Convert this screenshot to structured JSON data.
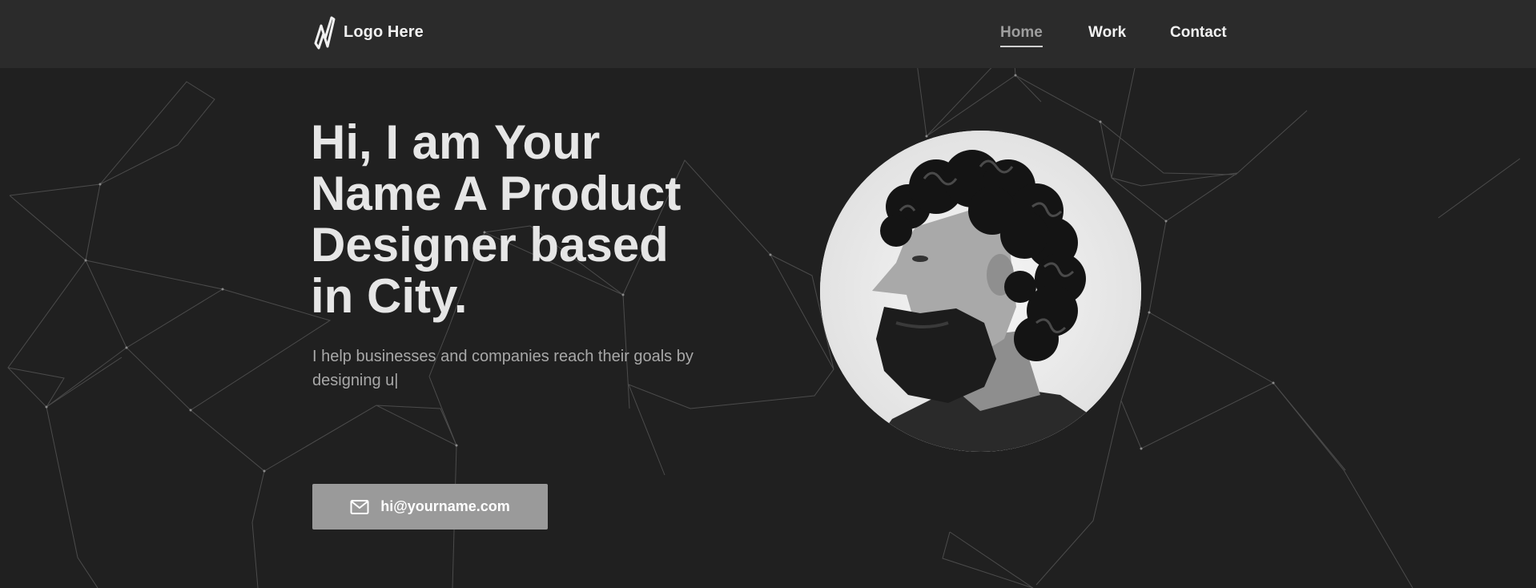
{
  "logo": {
    "text": "Logo Here",
    "icon": "zigzag-logo-icon"
  },
  "nav": {
    "items": [
      {
        "label": "Home",
        "active": true
      },
      {
        "label": "Work",
        "active": false
      },
      {
        "label": "Contact",
        "active": false
      }
    ]
  },
  "hero": {
    "title_lines": [
      "Hi, I am Your",
      "Name A Product",
      "Designer based",
      "in City."
    ],
    "description": "I help businesses and companies reach their goals by designing u|",
    "email_button": {
      "label": "hi@yourname.com",
      "icon": "mail-icon"
    }
  },
  "avatar": {
    "alt": "portrait-photo"
  },
  "colors": {
    "background": "#202020",
    "navbar": "#2b2b2b",
    "button": "#9a9a9a",
    "text": "#e6e6e6",
    "muted": "#a8a8a8"
  }
}
